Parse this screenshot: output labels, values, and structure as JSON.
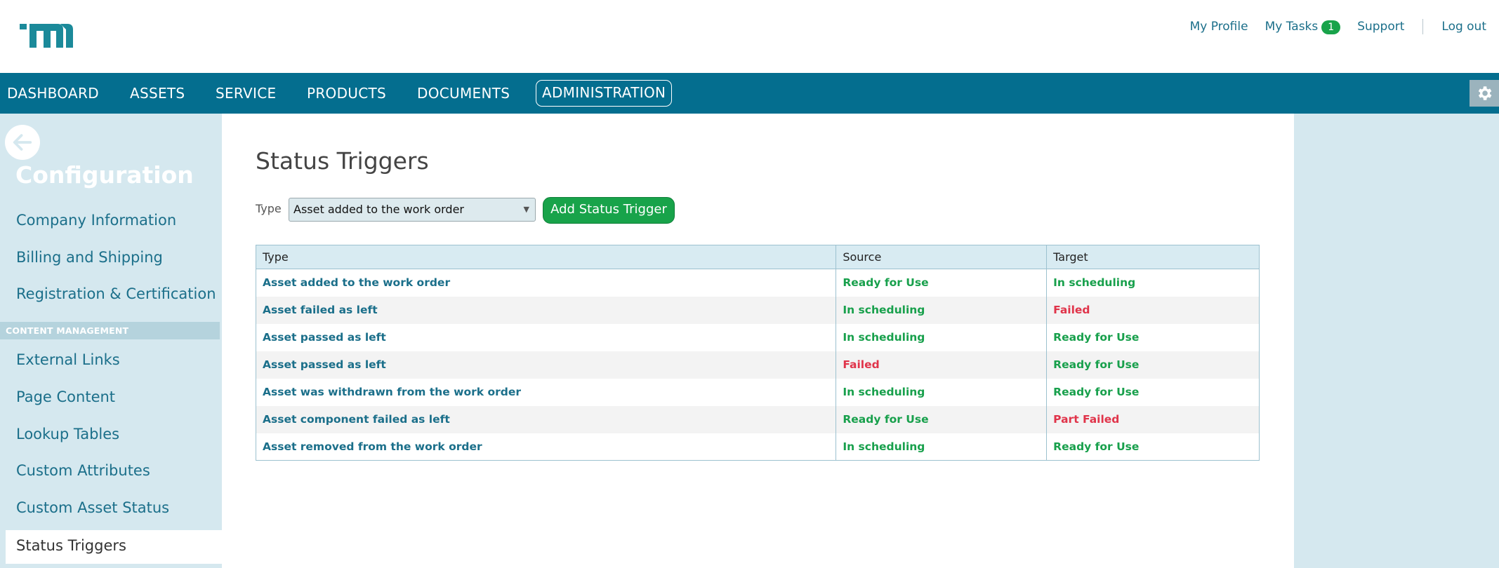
{
  "header": {
    "links": {
      "profile": "My Profile",
      "tasks": "My Tasks",
      "tasks_count": "1",
      "support": "Support",
      "logout": "Log out"
    }
  },
  "nav": {
    "items": [
      "DASHBOARD",
      "ASSETS",
      "SERVICE",
      "PRODUCTS",
      "DOCUMENTS",
      "ADMINISTRATION"
    ],
    "active": "ADMINISTRATION"
  },
  "sidebar": {
    "title": "Configuration",
    "items_top": [
      "Company Information",
      "Billing and Shipping",
      "Registration & Certification"
    ],
    "section": "CONTENT MANAGEMENT",
    "items_bottom": [
      "External Links",
      "Page Content",
      "Lookup Tables",
      "Custom Attributes",
      "Custom Asset Status"
    ],
    "active_item": "Status Triggers"
  },
  "main": {
    "title": "Status Triggers",
    "type_label": "Type",
    "type_value": "Asset added to the work order",
    "add_button": "Add Status Trigger",
    "table": {
      "headers": [
        "Type",
        "Source",
        "Target"
      ],
      "rows": [
        {
          "type": "Asset added to the work order",
          "source": "Ready for Use",
          "target": "In scheduling"
        },
        {
          "type": "Asset failed as left",
          "source": "In scheduling",
          "target": "Failed"
        },
        {
          "type": "Asset passed as left",
          "source": "In scheduling",
          "target": "Ready for Use"
        },
        {
          "type": "Asset passed as left",
          "source": "Failed",
          "target": "Ready for Use"
        },
        {
          "type": "Asset was withdrawn from the work order",
          "source": "In scheduling",
          "target": "Ready for Use"
        },
        {
          "type": "Asset component failed as left",
          "source": "Ready for Use",
          "target": "Part Failed"
        },
        {
          "type": "Asset removed from the work order",
          "source": "In scheduling",
          "target": "Ready for Use"
        }
      ]
    }
  },
  "colors": {
    "nav": "#046e8f",
    "accent_green": "#18a34a",
    "status_red": "#e0344a",
    "link": "#1b6f8a",
    "sidebar_bg": "#d5e8ef"
  },
  "icons": {
    "logo": "m-logo",
    "gear": "gear-icon",
    "back": "back-arrow-icon",
    "caret": "caret-down-icon"
  }
}
